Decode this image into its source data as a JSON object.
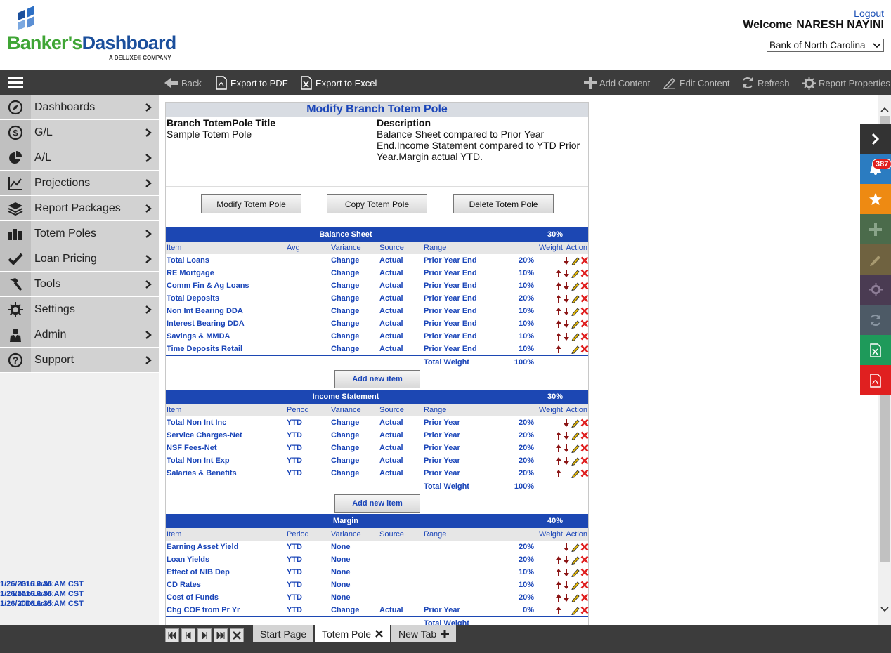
{
  "header": {
    "brand_green": "Banker's",
    "brand_blue": "Dashboard",
    "tagline": "A DELUXE® COMPANY",
    "logout": "Logout",
    "welcome_label": "Welcome",
    "user_name": "NARESH NAYINI",
    "bank": "Bank of North Carolina"
  },
  "toolbar": {
    "back": "Back",
    "export_pdf": "Export to PDF",
    "export_excel": "Export to Excel",
    "add_content": "Add Content",
    "edit_content": "Edit Content",
    "refresh": "Refresh",
    "report_properties": "Report Properties"
  },
  "sidebar": {
    "items": [
      {
        "label": "Dashboards",
        "icon": "compass-icon"
      },
      {
        "label": "G/L",
        "icon": "dollar-icon"
      },
      {
        "label": "A/L",
        "icon": "pie-chart-icon"
      },
      {
        "label": "Projections",
        "icon": "line-chart-icon"
      },
      {
        "label": "Report Packages",
        "icon": "layers-icon"
      },
      {
        "label": "Totem Poles",
        "icon": "bar-chart-icon"
      },
      {
        "label": "Loan Pricing",
        "icon": "checkmark-icon"
      },
      {
        "label": "Tools",
        "icon": "hammer-icon"
      },
      {
        "label": "Settings",
        "icon": "gear-icon"
      },
      {
        "label": "Admin",
        "icon": "user-icon"
      },
      {
        "label": "Support",
        "icon": "question-icon"
      }
    ],
    "loads": [
      {
        "label": "GL Load:",
        "value": "1/26/2016 6:36 AM CST"
      },
      {
        "label": "Loan Load:",
        "value": "1/26/2016 6:36 AM CST"
      },
      {
        "label": "CD Load:",
        "value": "1/26/2016 6:35 AM CST"
      }
    ]
  },
  "panel": {
    "title": "Modify Branch Totem Pole",
    "title_label": "Branch TotemPole Title",
    "title_value": "Sample Totem Pole",
    "desc_label": "Description",
    "desc_value": "Balance Sheet compared to Prior Year End.Income Statement compared to YTD Prior Year.Margin actual YTD.",
    "buttons": {
      "modify": "Modify Totem Pole",
      "copy": "Copy Totem Pole",
      "delete": "Delete Totem Pole"
    },
    "total_weight_label": "Total Weight",
    "add_item_label": "Add new item",
    "sections": [
      {
        "title": "Balance Sheet",
        "percent": "30%",
        "cols": {
          "item": "Item",
          "second": "Avg",
          "variance": "Variance",
          "source": "Source",
          "range": "Range",
          "weight": "Weight",
          "action": "Action"
        },
        "total": "100%",
        "rows": [
          {
            "item": "Total Loans",
            "second": "",
            "variance": "Change",
            "source": "Actual",
            "range": "Prior Year End",
            "weight": "20%",
            "up": false,
            "down": true
          },
          {
            "item": "RE Mortgage",
            "second": "",
            "variance": "Change",
            "source": "Actual",
            "range": "Prior Year End",
            "weight": "10%",
            "up": true,
            "down": true
          },
          {
            "item": "Comm Fin & Ag Loans",
            "second": "",
            "variance": "Change",
            "source": "Actual",
            "range": "Prior Year End",
            "weight": "10%",
            "up": true,
            "down": true
          },
          {
            "item": "Total Deposits",
            "second": "",
            "variance": "Change",
            "source": "Actual",
            "range": "Prior Year End",
            "weight": "20%",
            "up": true,
            "down": true
          },
          {
            "item": "Non Int Bearing DDA",
            "second": "",
            "variance": "Change",
            "source": "Actual",
            "range": "Prior Year End",
            "weight": "10%",
            "up": true,
            "down": true
          },
          {
            "item": "Interest Bearing DDA",
            "second": "",
            "variance": "Change",
            "source": "Actual",
            "range": "Prior Year End",
            "weight": "10%",
            "up": true,
            "down": true
          },
          {
            "item": "Savings & MMDA",
            "second": "",
            "variance": "Change",
            "source": "Actual",
            "range": "Prior Year End",
            "weight": "10%",
            "up": true,
            "down": true
          },
          {
            "item": "Time Deposits Retail",
            "second": "",
            "variance": "Change",
            "source": "Actual",
            "range": "Prior Year End",
            "weight": "10%",
            "up": true,
            "down": false
          }
        ]
      },
      {
        "title": "Income Statement",
        "percent": "30%",
        "cols": {
          "item": "Item",
          "second": "Period",
          "variance": "Variance",
          "source": "Source",
          "range": "Range",
          "weight": "Weight",
          "action": "Action"
        },
        "total": "100%",
        "rows": [
          {
            "item": "Total Non Int Inc",
            "second": "YTD",
            "variance": "Change",
            "source": "Actual",
            "range": "Prior Year",
            "weight": "20%",
            "up": false,
            "down": true
          },
          {
            "item": "Service Charges-Net",
            "second": "YTD",
            "variance": "Change",
            "source": "Actual",
            "range": "Prior Year",
            "weight": "20%",
            "up": true,
            "down": true
          },
          {
            "item": "NSF Fees-Net",
            "second": "YTD",
            "variance": "Change",
            "source": "Actual",
            "range": "Prior Year",
            "weight": "20%",
            "up": true,
            "down": true
          },
          {
            "item": "Total Non Int Exp",
            "second": "YTD",
            "variance": "Change",
            "source": "Actual",
            "range": "Prior Year",
            "weight": "20%",
            "up": true,
            "down": true
          },
          {
            "item": "Salaries & Benefits",
            "second": "YTD",
            "variance": "Change",
            "source": "Actual",
            "range": "Prior Year",
            "weight": "20%",
            "up": true,
            "down": false
          }
        ]
      },
      {
        "title": "Margin",
        "percent": "40%",
        "cols": {
          "item": "Item",
          "second": "Period",
          "variance": "Variance",
          "source": "Source",
          "range": "Range",
          "weight": "Weight",
          "action": "Action"
        },
        "total": "",
        "rows": [
          {
            "item": "Earning Asset Yield",
            "second": "YTD",
            "variance": "None",
            "source": "",
            "range": "",
            "weight": "20%",
            "up": false,
            "down": true
          },
          {
            "item": "Loan Yields",
            "second": "YTD",
            "variance": "None",
            "source": "",
            "range": "",
            "weight": "20%",
            "up": true,
            "down": true
          },
          {
            "item": "Effect of NIB Dep",
            "second": "YTD",
            "variance": "None",
            "source": "",
            "range": "",
            "weight": "10%",
            "up": true,
            "down": true
          },
          {
            "item": "CD Rates",
            "second": "YTD",
            "variance": "None",
            "source": "",
            "range": "",
            "weight": "10%",
            "up": true,
            "down": true
          },
          {
            "item": "Cost of Funds",
            "second": "YTD",
            "variance": "None",
            "source": "",
            "range": "",
            "weight": "20%",
            "up": true,
            "down": true
          },
          {
            "item": "Chg COF from Pr Yr",
            "second": "YTD",
            "variance": "Change",
            "source": "Actual",
            "range": "Prior Year",
            "weight": "0%",
            "up": true,
            "down": false
          }
        ]
      }
    ]
  },
  "dock": {
    "notifications_count": "387"
  },
  "tabs": {
    "start": "Start Page",
    "active": "Totem Pole",
    "new": "New Tab"
  },
  "colors": {
    "accent": "#1c47b3",
    "toolbar": "#3c3c3c",
    "arrow": "#8b1414",
    "delete": "#e02020"
  }
}
